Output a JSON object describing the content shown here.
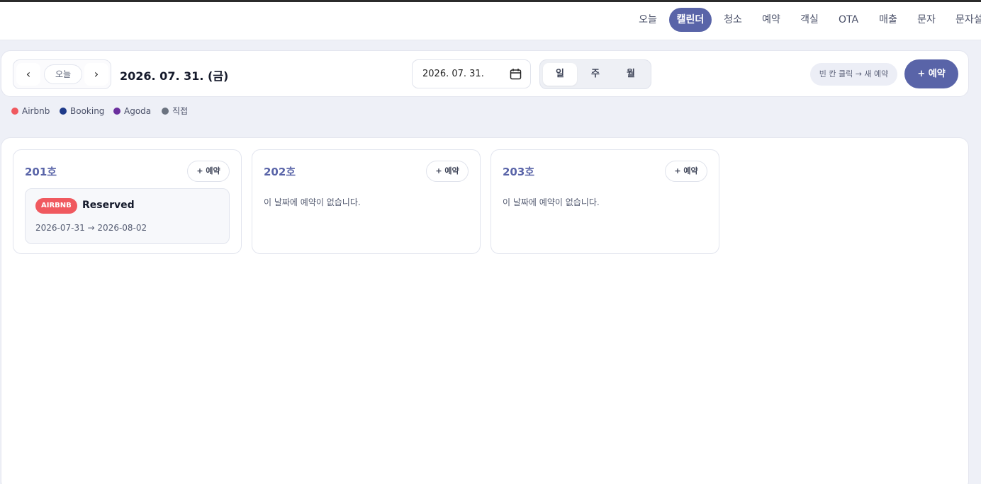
{
  "nav": {
    "items": [
      {
        "label": "오늘"
      },
      {
        "label": "캘린더"
      },
      {
        "label": "청소"
      },
      {
        "label": "예약"
      },
      {
        "label": "객실"
      },
      {
        "label": "OTA"
      },
      {
        "label": "매출"
      },
      {
        "label": "문자"
      },
      {
        "label": "문자설"
      }
    ],
    "active_index": 1
  },
  "toolbar": {
    "prev_label": "‹",
    "today_label": "오늘",
    "next_label": "›",
    "current_date": "2026. 07. 31. (금)",
    "date_input_value": "2026. 07. 31.",
    "views": [
      {
        "label": "일"
      },
      {
        "label": "주"
      },
      {
        "label": "월"
      }
    ],
    "active_view_index": 0,
    "hint": "빈 칸 클릭 → 새 예약",
    "new_reservation_label": "+ 예약"
  },
  "legend": [
    {
      "label": "Airbnb",
      "color": "#f0595f"
    },
    {
      "label": "Booking",
      "color": "#1e3a8a"
    },
    {
      "label": "Agoda",
      "color": "#6b2f9e"
    },
    {
      "label": "직접",
      "color": "#6b7380"
    }
  ],
  "rooms": [
    {
      "name": "201호",
      "add_label": "+ 예약",
      "reservation": {
        "source": "AIRBNB",
        "status": "Reserved",
        "dates": "2026-07-31 → 2026-08-02"
      }
    },
    {
      "name": "202호",
      "add_label": "+ 예약",
      "empty_message": "이 날짜에 예약이 없습니다."
    },
    {
      "name": "203호",
      "add_label": "+ 예약",
      "empty_message": "이 날짜에 예약이 없습니다."
    }
  ],
  "colors": {
    "accent": "#5964a8",
    "airbnb": "#f0595f"
  }
}
